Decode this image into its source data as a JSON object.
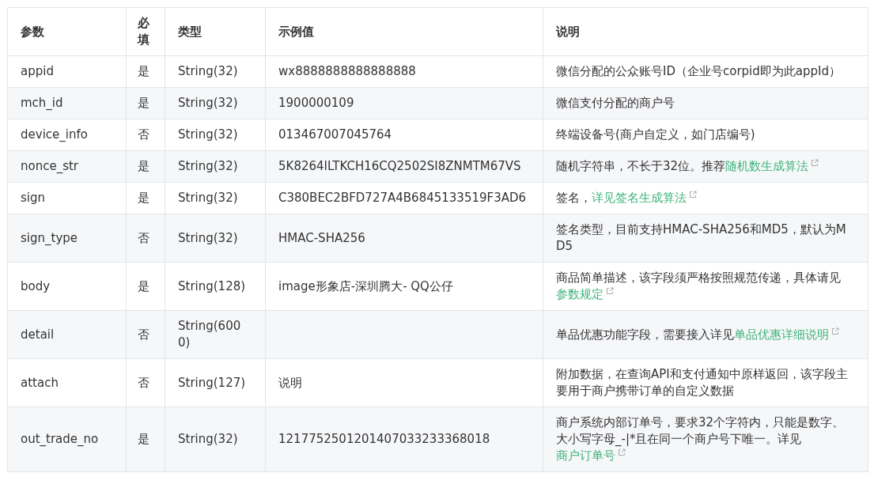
{
  "table": {
    "columns": [
      "参数",
      "必填",
      "类型",
      "示例值",
      "说明"
    ],
    "rows": [
      {
        "param": "appid",
        "required": "是",
        "type": "String(32)",
        "example": "wx8888888888888888",
        "description": "微信分配的公众账号ID（企业号corpid即为此appId）"
      },
      {
        "param": "mch_id",
        "required": "是",
        "type": "String(32)",
        "example": "1900000109",
        "description": "微信支付分配的商户号"
      },
      {
        "param": "device_info",
        "required": "否",
        "type": "String(32)",
        "example": "013467007045764",
        "description": "终端设备号(商户自定义，如门店编号)"
      },
      {
        "param": "nonce_str",
        "required": "是",
        "type": "String(32)",
        "example": "5K8264ILTKCH16CQ2502SI8ZNMTM67VS",
        "description": "随机字符串，不长于32位。推荐",
        "link": "随机数生成算法"
      },
      {
        "param": "sign",
        "required": "是",
        "type": "String(32)",
        "example": "C380BEC2BFD727A4B6845133519F3AD6",
        "description": "签名，",
        "link": "详见签名生成算法"
      },
      {
        "param": "sign_type",
        "required": "否",
        "type": "String(32)",
        "example": "HMAC-SHA256",
        "description": "签名类型，目前支持HMAC-SHA256和MD5，默认为MD5"
      },
      {
        "param": "body",
        "required": "是",
        "type": "String(128)",
        "example": "image形象店-深圳腾大- QQ公仔",
        "description": "商品简单描述，该字段须严格按照规范传递，具体请见",
        "link": "参数规定"
      },
      {
        "param": "detail",
        "required": "否",
        "type": "String(6000)",
        "description": "单品优惠功能字段，需要接入详见",
        "link": "单品优惠详细说明"
      },
      {
        "param": "attach",
        "required": "否",
        "type": "String(127)",
        "example": "说明",
        "description": "附加数据，在查询API和支付通知中原样返回，该字段主要用于商户携带订单的自定义数据"
      },
      {
        "param": "out_trade_no",
        "required": "是",
        "type": "String(32)",
        "example": "1217752501201407033233368018",
        "description": "商户系统内部订单号，要求32个字符内，只能是数字、大小写字母_-|*且在同一个商户号下唯一。详见",
        "link": "商户订单号"
      }
    ]
  }
}
